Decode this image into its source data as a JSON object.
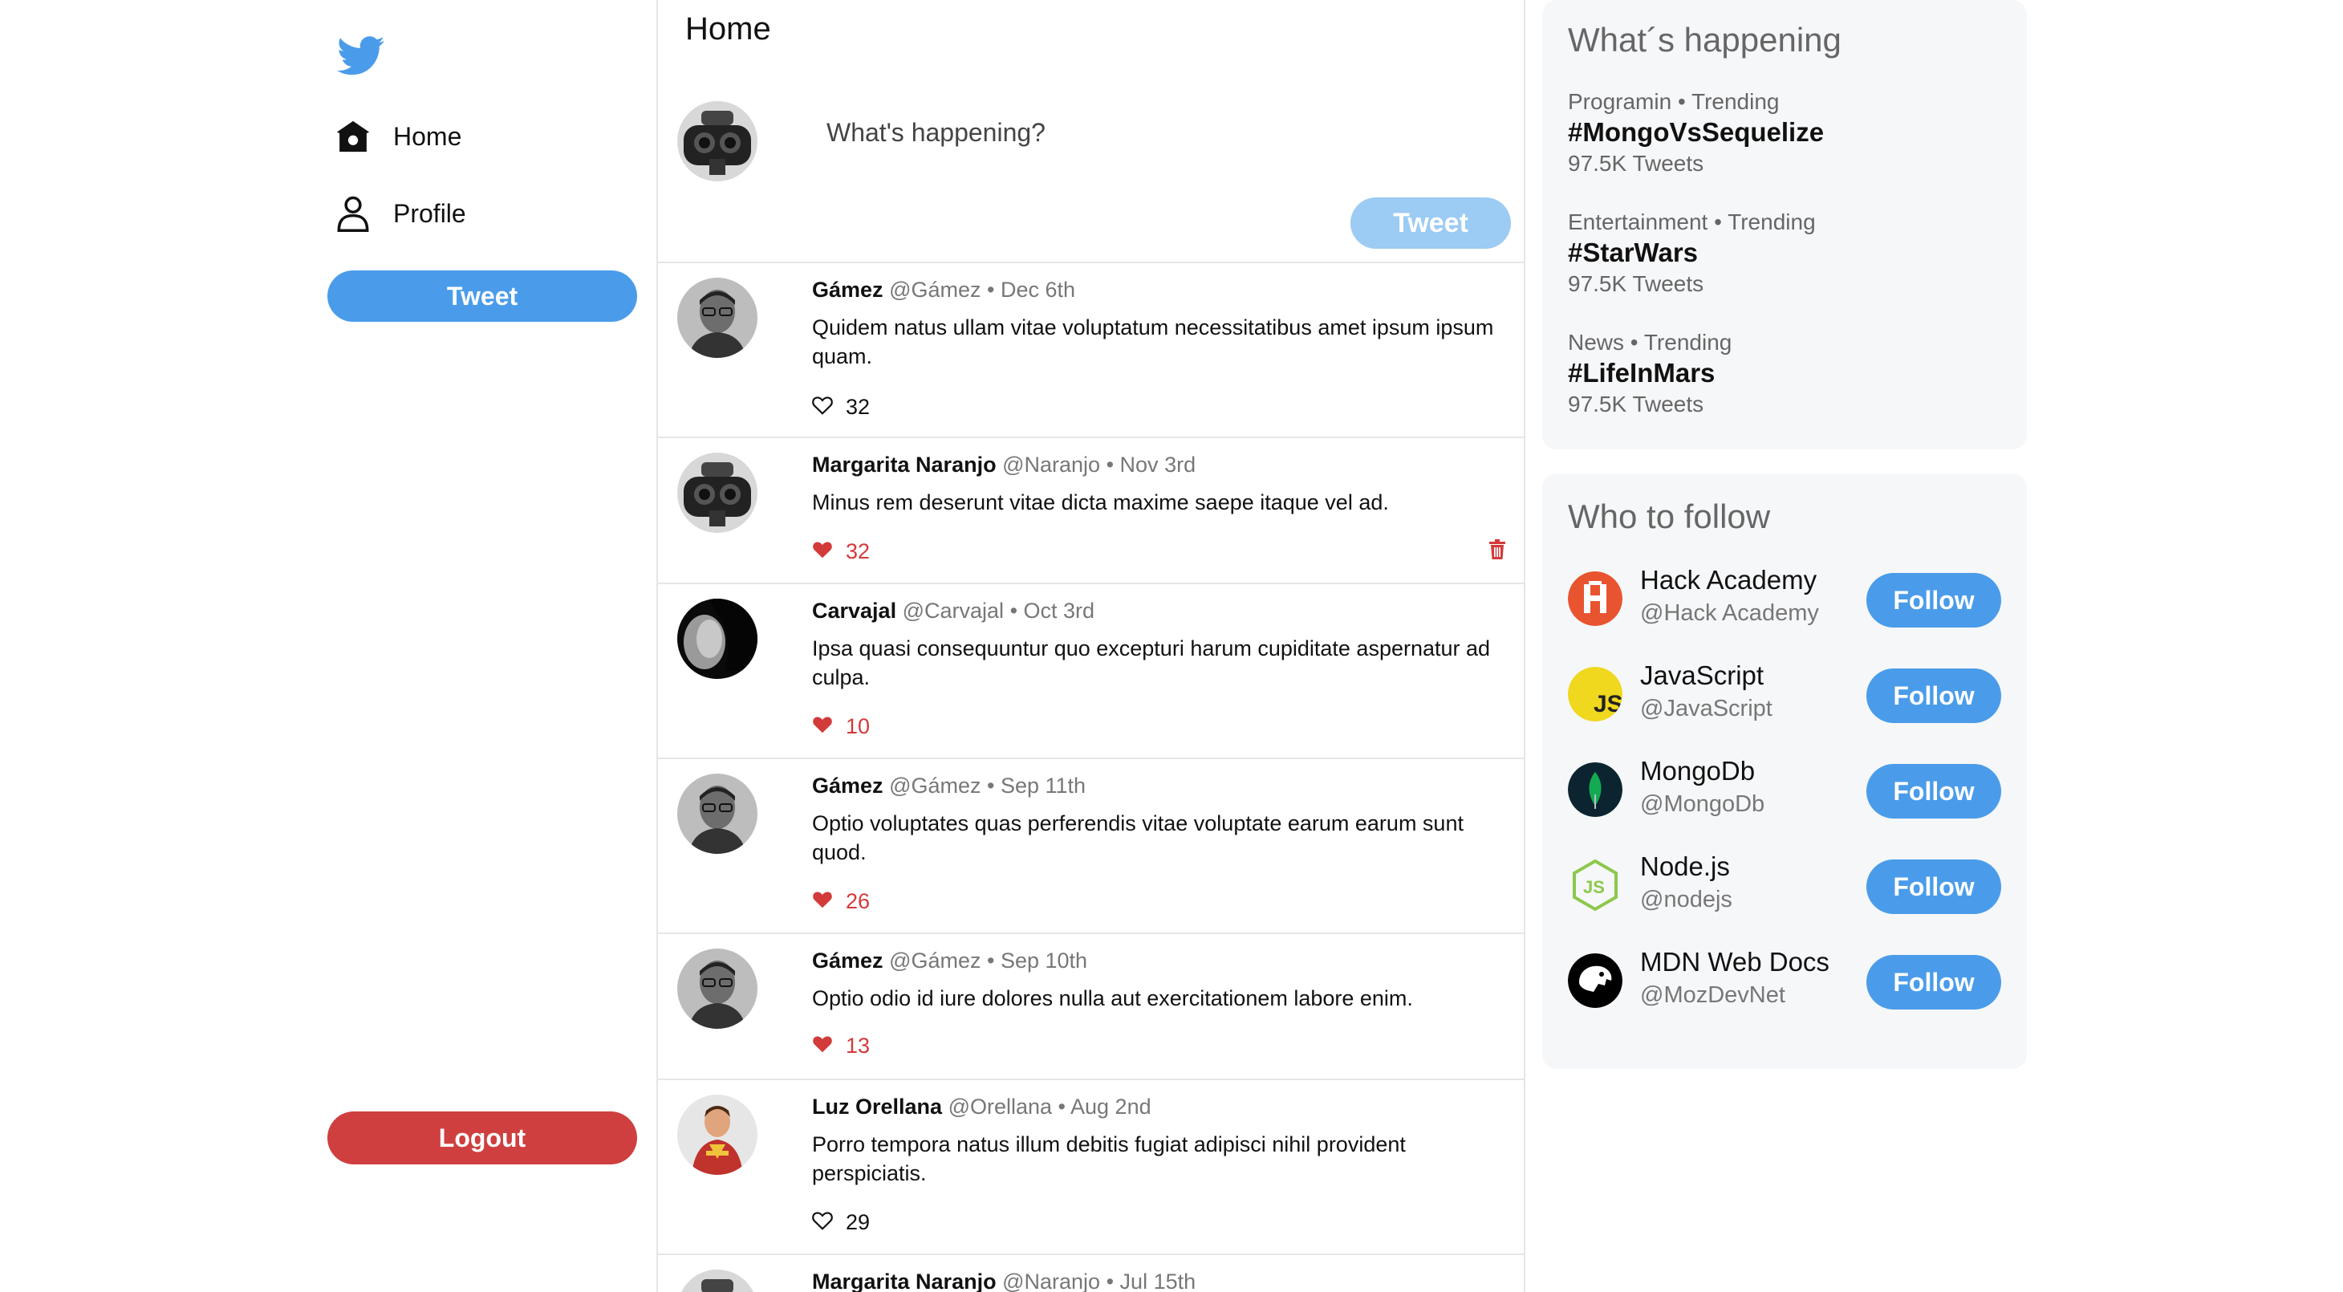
{
  "sidebar": {
    "nav": [
      {
        "label": "Home",
        "icon": "home-icon"
      },
      {
        "label": "Profile",
        "icon": "profile-icon"
      }
    ],
    "tweet_label": "Tweet",
    "logout_label": "Logout"
  },
  "feed": {
    "title": "Home",
    "composer": {
      "placeholder": "What's happening?",
      "button_label": "Tweet"
    },
    "tweets": [
      {
        "name": "Gámez",
        "handle": "@Gámez",
        "date": "Dec 6th",
        "text": "Quidem natus ullam vitae voluptatum necessitatibus amet ipsum ipsum quam.",
        "likes": "32",
        "liked": false,
        "deletable": false,
        "avatar": "man-glasses"
      },
      {
        "name": "Margarita Naranjo",
        "handle": "@Naranjo",
        "date": "Nov 3rd",
        "text": "Minus rem deserunt vitae dicta maxime saepe itaque vel ad.",
        "likes": "32",
        "liked": true,
        "deletable": true,
        "avatar": "binoculars"
      },
      {
        "name": "Carvajal",
        "handle": "@Carvajal",
        "date": "Oct 3rd",
        "text": "Ipsa quasi consequuntur quo excepturi harum cupiditate aspernatur ad culpa.",
        "likes": "10",
        "liked": true,
        "deletable": false,
        "avatar": "dark-face"
      },
      {
        "name": "Gámez",
        "handle": "@Gámez",
        "date": "Sep 11th",
        "text": "Optio voluptates quas perferendis vitae voluptate earum earum sunt quod.",
        "likes": "26",
        "liked": true,
        "deletable": false,
        "avatar": "man-glasses"
      },
      {
        "name": "Gámez",
        "handle": "@Gámez",
        "date": "Sep 10th",
        "text": "Optio odio id iure dolores nulla aut exercitationem labore enim.",
        "likes": "13",
        "liked": true,
        "deletable": false,
        "avatar": "man-glasses"
      },
      {
        "name": "Luz Orellana",
        "handle": "@Orellana",
        "date": "Aug 2nd",
        "text": "Porro tempora natus illum debitis fugiat adipisci nihil provident perspiciatis.",
        "likes": "29",
        "liked": false,
        "deletable": false,
        "avatar": "hero"
      },
      {
        "name": "Margarita Naranjo",
        "handle": "@Naranjo",
        "date": "Jul 15th",
        "text": "",
        "likes": "",
        "liked": false,
        "deletable": false,
        "avatar": "binoculars"
      }
    ]
  },
  "trends": {
    "title": "What´s happening",
    "items": [
      {
        "meta": "Programin • Trending",
        "tag": "#MongoVsSequelize",
        "count": "97.5K Tweets"
      },
      {
        "meta": "Entertainment • Trending",
        "tag": "#StarWars",
        "count": "97.5K Tweets"
      },
      {
        "meta": "News • Trending",
        "tag": "#LifeInMars",
        "count": "97.5K Tweets"
      }
    ]
  },
  "who_to_follow": {
    "title": "Who to follow",
    "items": [
      {
        "name": "Hack Academy",
        "handle": "@Hack Academy",
        "button": "Follow",
        "logo": "hack-academy-logo",
        "color": "#e8542f"
      },
      {
        "name": "JavaScript",
        "handle": "@JavaScript",
        "button": "Follow",
        "logo": "javascript-logo",
        "color": "#efd81d"
      },
      {
        "name": "MongoDb",
        "handle": "@MongoDb",
        "button": "Follow",
        "logo": "mongodb-logo",
        "color": "#13aa52"
      },
      {
        "name": "Node.js",
        "handle": "@nodejs",
        "button": "Follow",
        "logo": "nodejs-logo",
        "color": "#8cc84b"
      },
      {
        "name": "MDN Web Docs",
        "handle": "@MozDevNet",
        "button": "Follow",
        "logo": "mdn-logo",
        "color": "#000000"
      }
    ]
  },
  "colors": {
    "accent": "#4a9cea",
    "accent_disabled": "#9ccbf3",
    "danger": "#cf3f3f",
    "like": "#d33a3a"
  }
}
